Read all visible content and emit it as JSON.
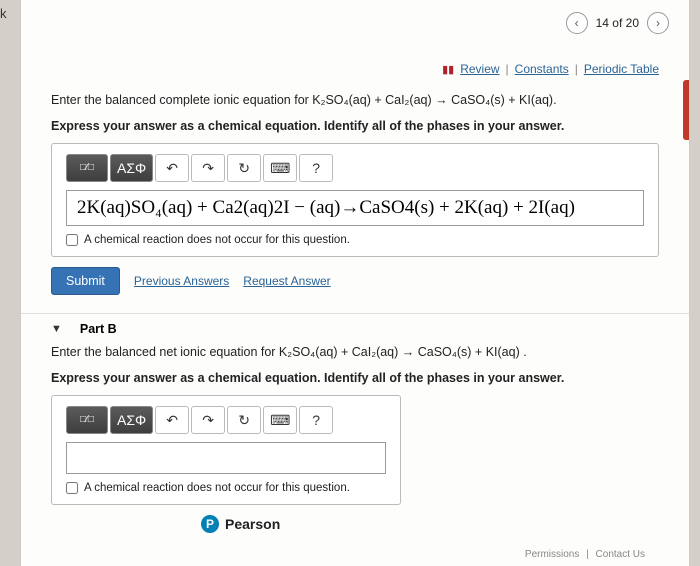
{
  "nav": {
    "prev": "‹",
    "next": "›",
    "counter": "14 of 20"
  },
  "review_bar": {
    "review": "Review",
    "constants": "Constants",
    "periodic": "Periodic Table"
  },
  "partA": {
    "prompt_html": "Enter the balanced complete ionic equation for K₂SO₄(aq)  +  CaI₂(aq)  →  CaSO₄(s)  +  KI(aq).",
    "instruction": "Express your answer as a chemical equation. Identify all of the phases in your answer.",
    "toolbar": {
      "frac": "□⁄□",
      "greek": "ΑΣΦ",
      "undo": "↶",
      "redo": "↷",
      "reset": "↻",
      "keyboard": "⌨",
      "help": "?"
    },
    "formula": "2K(aq)SO₄(aq) + Ca2(aq)2I − (aq)→CaSO4(s) + 2K(aq) + 2I(aq)",
    "no_reaction": "A chemical reaction does not occur for this question.",
    "submit": "Submit",
    "prev_answers": "Previous Answers",
    "request": "Request Answer"
  },
  "partB": {
    "title": "Part B",
    "prompt_html": "Enter the balanced net ionic equation for K₂SO₄(aq)  +  CaI₂(aq)  →  CaSO₄(s)  +  KI(aq) .",
    "instruction": "Express your answer as a chemical equation. Identify all of the phases in your answer.",
    "no_reaction": "A chemical reaction does not occur for this question."
  },
  "pearson": {
    "p": "P",
    "label": "Pearson"
  },
  "footer": {
    "perm": "Permissions",
    "contact": "Contact Us"
  },
  "edge_k": "k"
}
